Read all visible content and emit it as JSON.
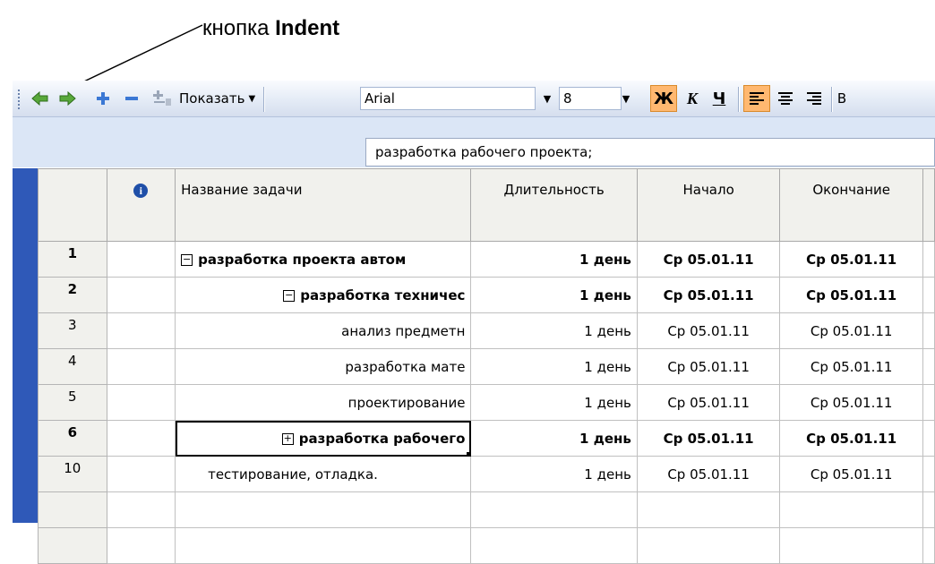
{
  "annotation": {
    "prefix": "кнопка ",
    "bold": "Indent"
  },
  "toolbar": {
    "outdent_icon": "green-left-arrow-icon",
    "indent_icon": "green-right-arrow-icon",
    "show_subtasks_icon": "plus-icon",
    "hide_subtasks_icon": "minus-icon",
    "show_label": "Показать",
    "font_name": "Arial",
    "font_size": "8",
    "bold_label": "Ж",
    "italic_label": "К",
    "underline_label": "Ч",
    "cut_label": "В",
    "colors": {
      "active_format": "#ffb870",
      "toolbar_bg": "#e4ebf6"
    }
  },
  "entry_bar": {
    "value": "разработка рабочего проекта;"
  },
  "grid": {
    "headers": {
      "info": "info-icon",
      "name": "Название задачи",
      "duration": "Длительность",
      "start": "Начало",
      "finish": "Окончание"
    },
    "rows": [
      {
        "id": "1",
        "name": "разработка проекта автом",
        "duration": "1 день",
        "start": "Ср 05.01.11",
        "finish": "Ср 05.01.11"
      },
      {
        "id": "2",
        "name": "разработка техничес",
        "duration": "1 день",
        "start": "Ср 05.01.11",
        "finish": "Ср 05.01.11"
      },
      {
        "id": "3",
        "name": "анализ предметн",
        "duration": "1 день",
        "start": "Ср 05.01.11",
        "finish": "Ср 05.01.11"
      },
      {
        "id": "4",
        "name": "разработка мате",
        "duration": "1 день",
        "start": "Ср 05.01.11",
        "finish": "Ср 05.01.11"
      },
      {
        "id": "5",
        "name": "проектирование",
        "duration": "1 день",
        "start": "Ср 05.01.11",
        "finish": "Ср 05.01.11"
      },
      {
        "id": "6",
        "name": "разработка рабочего",
        "duration": "1 день",
        "start": "Ср 05.01.11",
        "finish": "Ср 05.01.11"
      },
      {
        "id": "10",
        "name": "тестирование, отладка.",
        "duration": "1 день",
        "start": "Ср 05.01.11",
        "finish": "Ср 05.01.11"
      }
    ]
  }
}
